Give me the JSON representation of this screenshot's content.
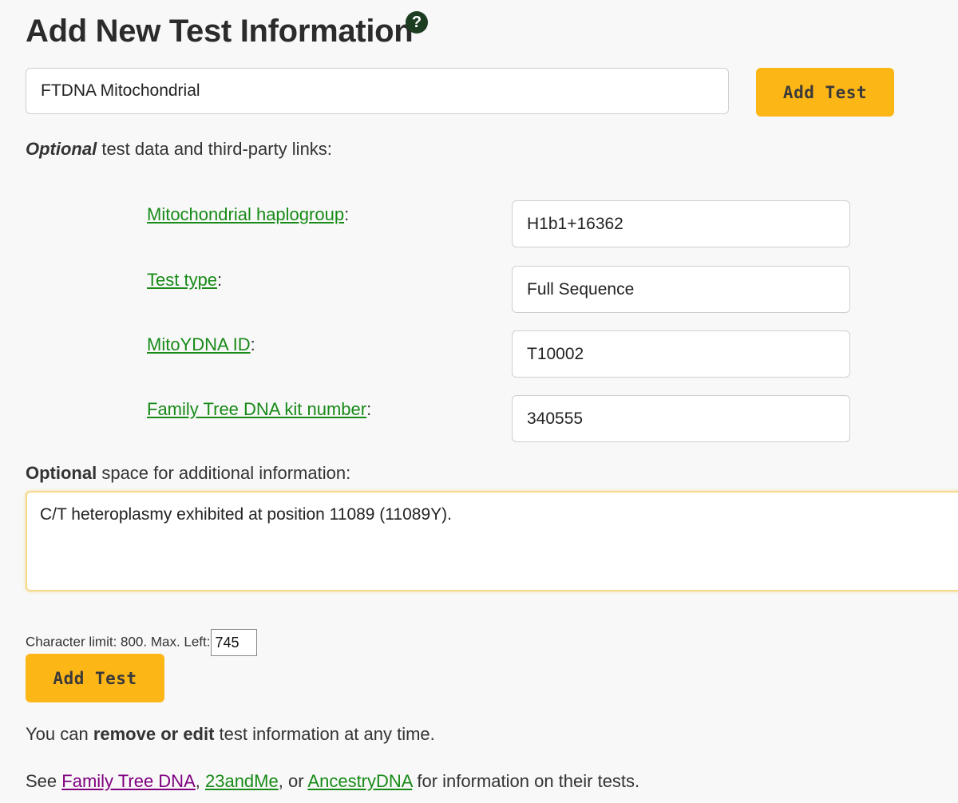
{
  "header": {
    "title": "Add New Test Information",
    "help_glyph": "?",
    "help_icon": "question-circle-icon"
  },
  "test_name": {
    "value": "FTDNA Mitochondrial"
  },
  "add_test_label": "Add Test",
  "optional_links": {
    "bold": "Optional",
    "rest": " test data and third-party links:"
  },
  "fields": [
    {
      "label": "Mitochondrial haplogroup",
      "suffix": ":",
      "value": "H1b1+16362"
    },
    {
      "label": "Test type",
      "suffix": ":",
      "value": "Full Sequence"
    },
    {
      "label": "MitoYDNA ID",
      "suffix": ":",
      "value": "T10002"
    },
    {
      "label": "Family Tree DNA kit number",
      "suffix": ":",
      "value": "340555"
    }
  ],
  "optional_space": {
    "bold": "Optional",
    "rest": " space for additional information:"
  },
  "notes": {
    "value": "C/T heteroplasmy exhibited at position 11089 (11089Y). "
  },
  "char_limit": {
    "label": "Character limit: 800. Max. Left:",
    "value": "745"
  },
  "remove_edit": {
    "before": "You can ",
    "bold": "remove or edit",
    "after": " test information at any time."
  },
  "see_links": {
    "before": "See ",
    "link1": "Family Tree DNA",
    "sep1": ", ",
    "link2": "23andMe",
    "sep2": ", or ",
    "link3": "AncestryDNA",
    "after": " for information on their tests."
  },
  "colors": {
    "button": "#fcb616",
    "link_green": "#178a17",
    "link_visited": "#800080",
    "help_icon_bg": "#1d3d21"
  }
}
